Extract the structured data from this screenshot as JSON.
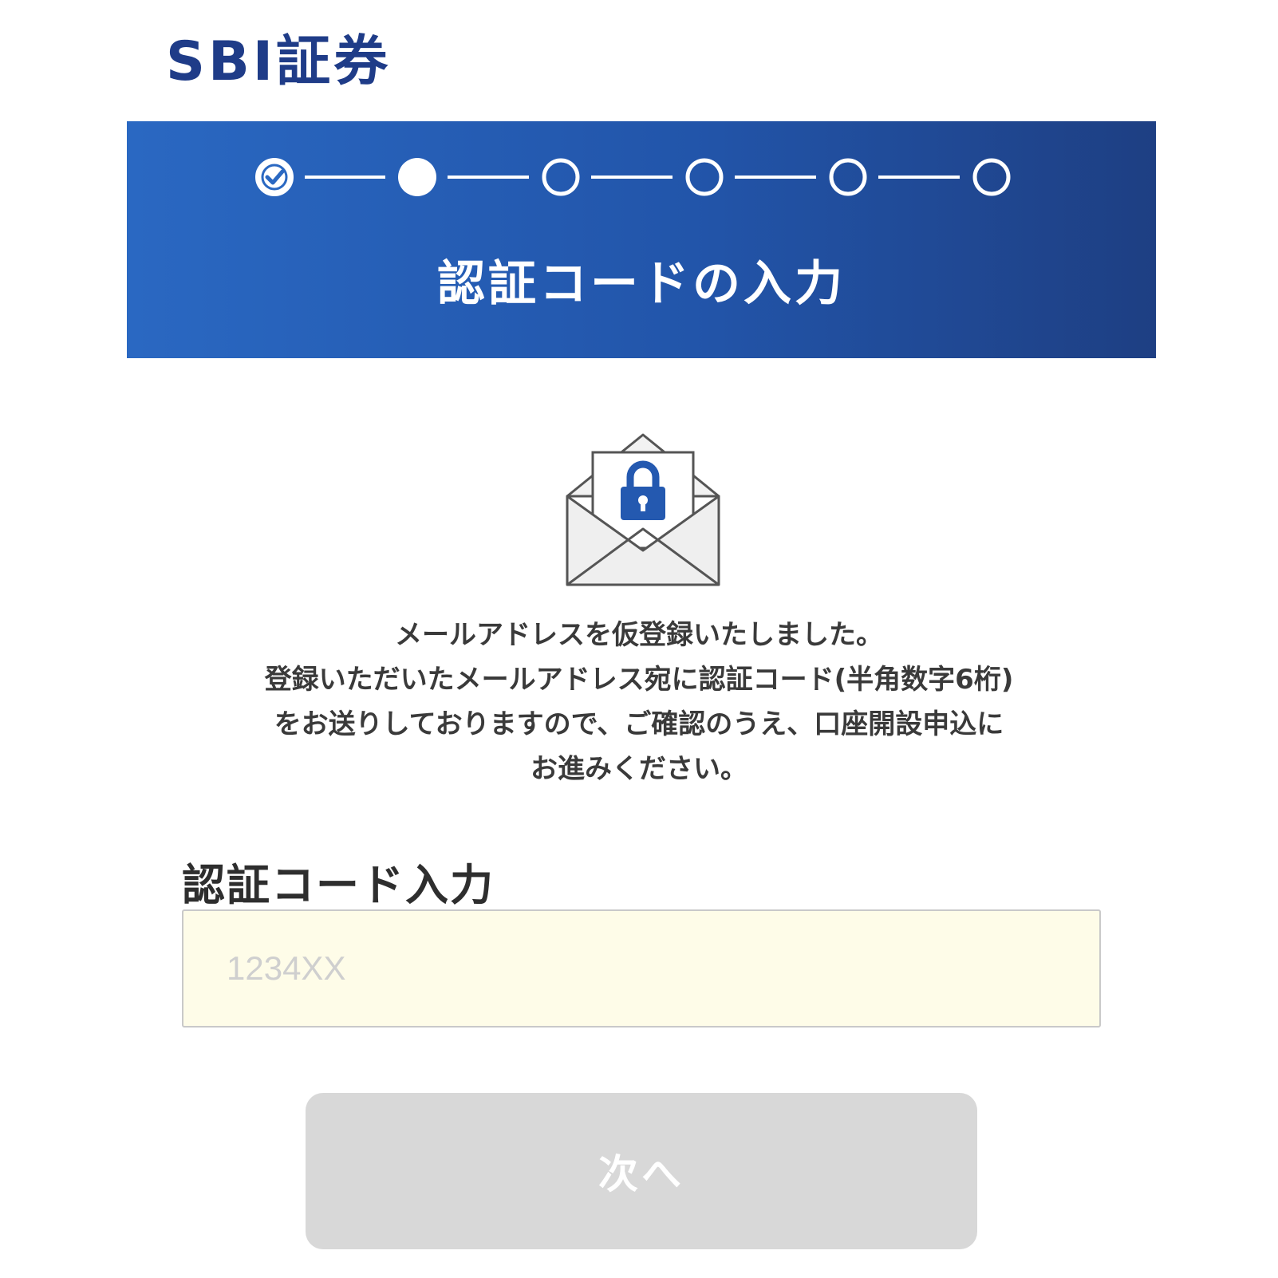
{
  "header": {
    "logo_text": "SBI証券"
  },
  "progress": {
    "total_steps": 6,
    "completed_steps": 1,
    "current_step": 2,
    "title": "認証コードの入力"
  },
  "message": {
    "lines": [
      "メールアドレスを仮登録いたしました。",
      "登録いただいたメールアドレス宛に認証コード(半角数字6桁)",
      "をお送りしておりますので、ご確認のうえ、口座開設申込に",
      "お進みください。"
    ],
    "icon": "mail-lock-icon"
  },
  "form": {
    "label": "認証コード入力",
    "input_value": "",
    "input_placeholder": "1234XX",
    "submit_label": "次へ"
  },
  "colors": {
    "brand": "#1f3c88",
    "banner_start": "#2a68c2",
    "banner_end": "#1e3f83",
    "lock": "#2459b0",
    "input_bg": "#fefce8",
    "button_disabled": "#d8d8d8"
  }
}
